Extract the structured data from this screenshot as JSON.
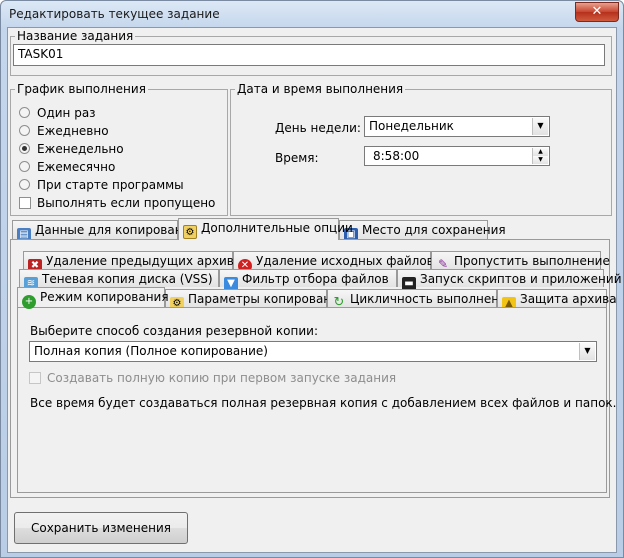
{
  "window": {
    "title": "Редактировать текущее задание",
    "close_label": "✕"
  },
  "task_name": {
    "label": "Название задания",
    "value": "TASK01"
  },
  "schedule": {
    "label": "График выполнения",
    "options": [
      "Один раз",
      "Ежедневно",
      "Еженедельно",
      "Ежемесячно",
      "При старте программы"
    ],
    "selected": "Еженедельно",
    "run_if_missed": "Выполнять если пропущено"
  },
  "datetime": {
    "label": "Дата и время выполнения",
    "day_label": "День недели:",
    "day_value": "Понедельник",
    "time_label": "Время:",
    "time_value": "8:58:00"
  },
  "main_tabs": [
    {
      "label": "Данные для копирования",
      "icon": "data-icon"
    },
    {
      "label": "Дополнительные опции",
      "icon": "options-icon"
    },
    {
      "label": "Место для сохранения",
      "icon": "save-location-icon"
    }
  ],
  "sub_tabs_row1": [
    {
      "label": "Удаление предыдущих архивов",
      "icon": "delete-archive-icon"
    },
    {
      "label": "Удаление исходных файлов",
      "icon": "delete-source-icon"
    },
    {
      "label": "Пропустить выполнение",
      "icon": "skip-icon"
    }
  ],
  "sub_tabs_row2": [
    {
      "label": "Теневая копия диска (VSS)",
      "icon": "shadow-copy-icon"
    },
    {
      "label": "Фильтр отбора файлов",
      "icon": "filter-icon"
    },
    {
      "label": "Запуск скриптов и приложений",
      "icon": "script-icon"
    }
  ],
  "sub_tabs_row3": [
    {
      "label": "Режим копирования",
      "icon": "copy-mode-icon"
    },
    {
      "label": "Параметры копирования",
      "icon": "copy-params-icon"
    },
    {
      "label": "Цикличность выполнения",
      "icon": "cycle-icon"
    },
    {
      "label": "Защита архива",
      "icon": "lock-icon"
    }
  ],
  "copy_mode": {
    "prompt": "Выберите способ создания резервной копии:",
    "selected": "Полная копия (Полное копирование)",
    "first_run_checkbox": "Создавать полную копию при первом запуске задания",
    "description": "Все время будет создаваться полная резервная копия с добавлением всех файлов и папок."
  },
  "save_button": "Сохранить изменения",
  "colors": {
    "title_bg": "#c4d6ec",
    "client_bg": "#f0f0f0",
    "close_red": "#c9442e"
  }
}
